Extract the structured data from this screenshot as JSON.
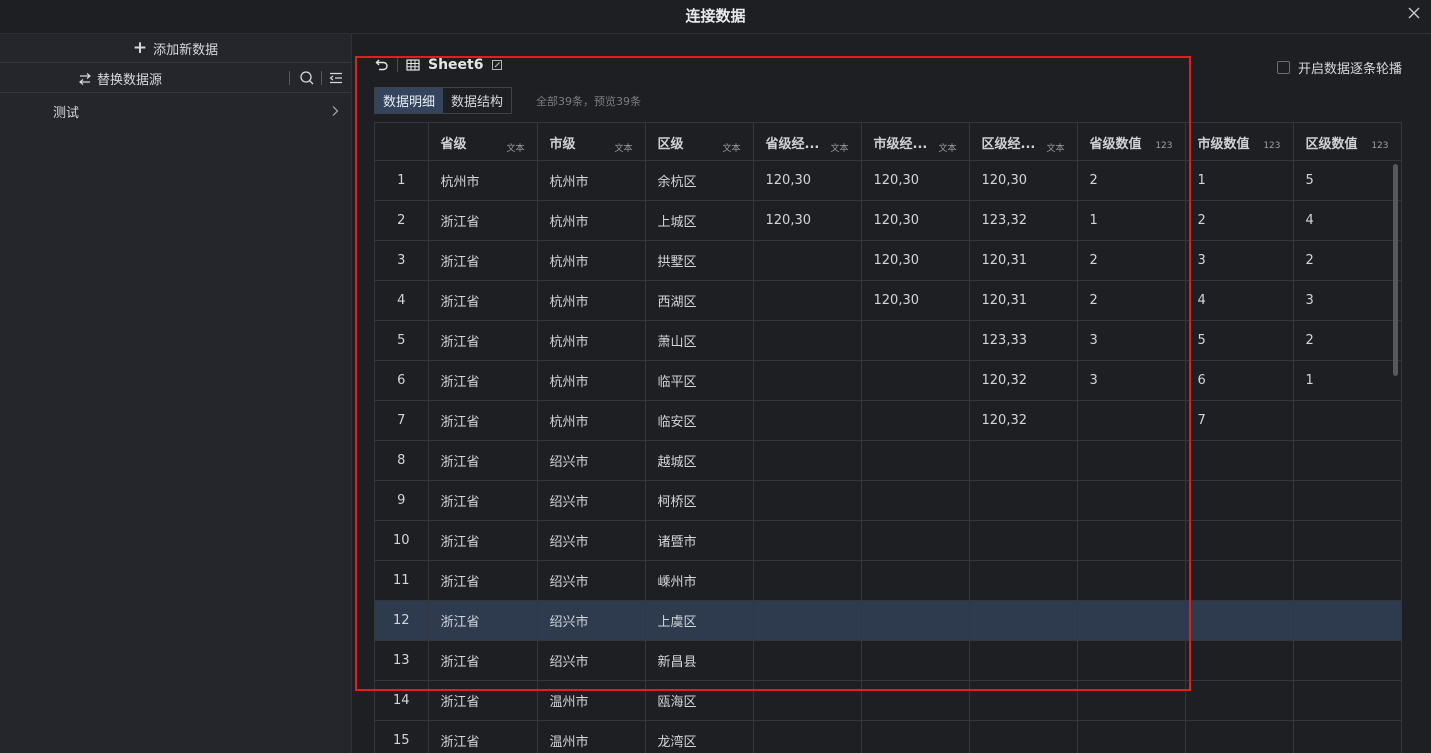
{
  "window": {
    "title": "连接数据"
  },
  "sidebar": {
    "add_label": "添加新数据",
    "replace_label": "替换数据源",
    "items": [
      {
        "label": "测试"
      }
    ]
  },
  "toolbar": {
    "sheet_name": "Sheet6",
    "carousel_label": "开启数据逐条轮播",
    "tabs": [
      {
        "label": "数据明细"
      },
      {
        "label": "数据结构"
      }
    ],
    "count_text": "全部39条，预览39条"
  },
  "table": {
    "columns": [
      {
        "label": "省级",
        "type": "文本"
      },
      {
        "label": "市级",
        "type": "文本"
      },
      {
        "label": "区级",
        "type": "文本"
      },
      {
        "label": "省级经...",
        "type": "文本"
      },
      {
        "label": "市级经...",
        "type": "文本"
      },
      {
        "label": "区级经...",
        "type": "文本"
      },
      {
        "label": "省级数值",
        "type": "123"
      },
      {
        "label": "市级数值",
        "type": "123"
      },
      {
        "label": "区级数值",
        "type": "123"
      }
    ],
    "rows": [
      [
        "1",
        "杭州市",
        "杭州市",
        "余杭区",
        "120,30",
        "120,30",
        "120,30",
        "2",
        "1",
        "5"
      ],
      [
        "2",
        "浙江省",
        "杭州市",
        "上城区",
        "120,30",
        "120,30",
        "123,32",
        "1",
        "2",
        "4"
      ],
      [
        "3",
        "浙江省",
        "杭州市",
        "拱墅区",
        "",
        "120,30",
        "120,31",
        "2",
        "3",
        "2"
      ],
      [
        "4",
        "浙江省",
        "杭州市",
        "西湖区",
        "",
        "120,30",
        "120,31",
        "2",
        "4",
        "3"
      ],
      [
        "5",
        "浙江省",
        "杭州市",
        "萧山区",
        "",
        "",
        "123,33",
        "3",
        "5",
        "2"
      ],
      [
        "6",
        "浙江省",
        "杭州市",
        "临平区",
        "",
        "",
        "120,32",
        "3",
        "6",
        "1"
      ],
      [
        "7",
        "浙江省",
        "杭州市",
        "临安区",
        "",
        "",
        "120,32",
        "",
        "7",
        ""
      ],
      [
        "8",
        "浙江省",
        "绍兴市",
        "越城区",
        "",
        "",
        "",
        "",
        "",
        ""
      ],
      [
        "9",
        "浙江省",
        "绍兴市",
        "柯桥区",
        "",
        "",
        "",
        "",
        "",
        ""
      ],
      [
        "10",
        "浙江省",
        "绍兴市",
        "诸暨市",
        "",
        "",
        "",
        "",
        "",
        ""
      ],
      [
        "11",
        "浙江省",
        "绍兴市",
        "嵊州市",
        "",
        "",
        "",
        "",
        "",
        ""
      ],
      [
        "12",
        "浙江省",
        "绍兴市",
        "上虞区",
        "",
        "",
        "",
        "",
        "",
        ""
      ],
      [
        "13",
        "浙江省",
        "绍兴市",
        "新昌县",
        "",
        "",
        "",
        "",
        "",
        ""
      ],
      [
        "14",
        "浙江省",
        "温州市",
        "瓯海区",
        "",
        "",
        "",
        "",
        "",
        ""
      ],
      [
        "15",
        "浙江省",
        "温州市",
        "龙湾区",
        "",
        "",
        "",
        "",
        "",
        ""
      ]
    ],
    "selected_row": 11
  },
  "colors": {
    "accent_tab": "#34445c",
    "selected_row": "#2e3a4d",
    "highlight_border": "#e0201d"
  }
}
